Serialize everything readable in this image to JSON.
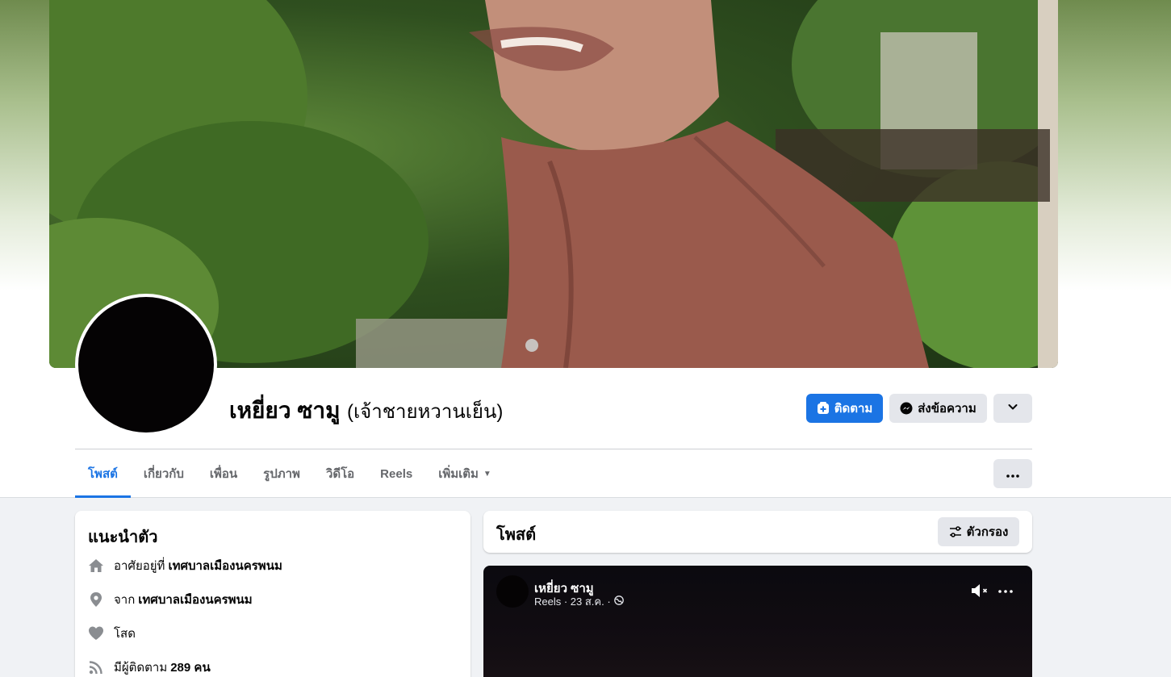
{
  "profile": {
    "name": "เหยี่ยว ซามู",
    "alternate_name": "(เจ้าชายหวานเย็น)"
  },
  "actions": {
    "follow_label": "ติดตาม",
    "message_label": "ส่งข้อความ"
  },
  "tabs": [
    {
      "label": "โพสต์",
      "active": true
    },
    {
      "label": "เกี่ยวกับ",
      "active": false
    },
    {
      "label": "เพื่อน",
      "active": false
    },
    {
      "label": "รูปภาพ",
      "active": false
    },
    {
      "label": "วิดีโอ",
      "active": false
    },
    {
      "label": "Reels",
      "active": false
    },
    {
      "label": "เพิ่มเติม",
      "active": false
    }
  ],
  "intro": {
    "title": "แนะนำตัว",
    "lives_prefix": "อาศัยอยู่ที่",
    "lives_place": "เทศบาลเมืองนครพนม",
    "from_prefix": "จาก",
    "from_place": "เทศบาลเมืองนครพนม",
    "relationship": "โสด",
    "followers_prefix": "มีผู้ติดตาม",
    "followers_count": "289 คน"
  },
  "posts": {
    "title": "โพสต์",
    "filter_label": "ตัวกรอง"
  },
  "reel": {
    "author": "เหยี่ยว ซามู",
    "meta": "Reels · 23 ส.ค. ·"
  },
  "colors": {
    "accent": "#1b74e4",
    "secondary_button": "#e4e6eb",
    "page_background": "#f0f2f5"
  },
  "icons": {
    "follow": "follow-plus-icon",
    "message": "messenger-icon",
    "chevron": "chevron-down-icon",
    "more": "more-dots-icon",
    "home": "home-icon",
    "location": "location-pin-icon",
    "heart": "heart-icon",
    "rss": "rss-icon",
    "filter": "filter-sliders-icon",
    "globe": "globe-icon",
    "mute": "muted-speaker-icon"
  }
}
